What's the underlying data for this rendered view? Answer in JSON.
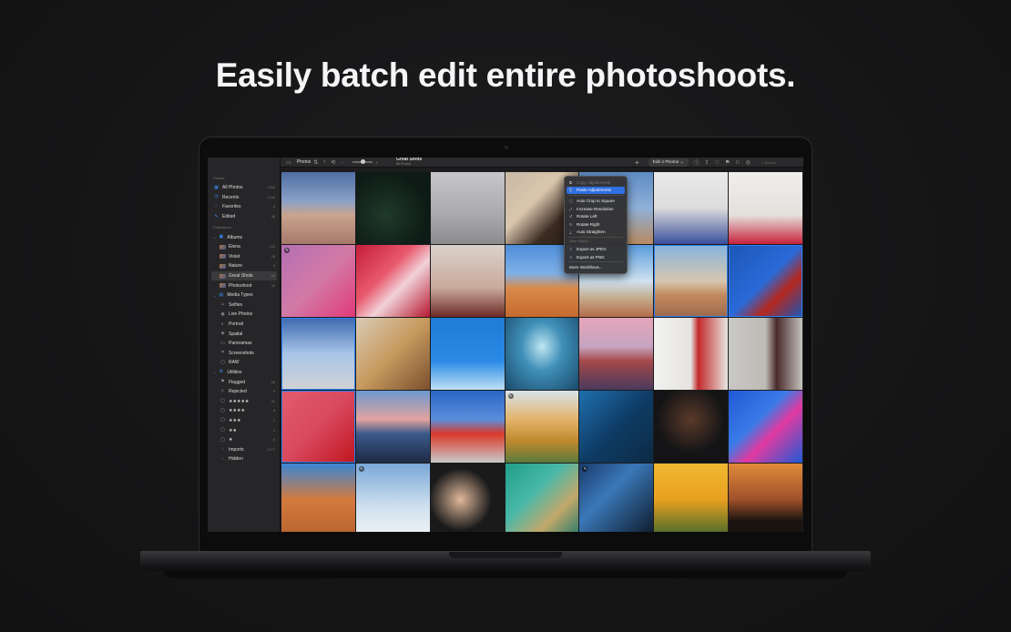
{
  "headline": "Easily batch edit entire photoshoots.",
  "sidebar": {
    "sections": [
      {
        "header": "Photos",
        "items": [
          {
            "label": "All Photos",
            "count": "1250",
            "icon": "photos-icon"
          },
          {
            "label": "Recents",
            "count": "1246",
            "icon": "clock-icon"
          },
          {
            "label": "Favorites",
            "count": "8",
            "icon": "heart-icon"
          },
          {
            "label": "Edited",
            "count": "48",
            "icon": "edit-icon"
          }
        ]
      },
      {
        "header": "Collections",
        "items": []
      }
    ],
    "albums_label": "Albums",
    "albums": [
      {
        "label": "Elena",
        "count": "124"
      },
      {
        "label": "Violet",
        "count": "26"
      },
      {
        "label": "Nature",
        "count": "9"
      },
      {
        "label": "Great Shots",
        "count": "66"
      },
      {
        "label": "Photoshoot",
        "count": "32"
      }
    ],
    "media_types_label": "Media Types",
    "media_types": [
      "Selfies",
      "Live Photos",
      "Portrait",
      "Spatial",
      "Panoramas",
      "Screenshots",
      "RAW"
    ],
    "utilities_label": "Utilities",
    "utilities": [
      {
        "label": "Flagged",
        "count": "26"
      },
      {
        "label": "Rejected",
        "count": "9"
      },
      {
        "label": "★★★★★",
        "count": "31"
      },
      {
        "label": "★★★★",
        "count": "8"
      },
      {
        "label": "★★★",
        "count": "2"
      },
      {
        "label": "★★",
        "count": "3"
      },
      {
        "label": "★",
        "count": "6"
      },
      {
        "label": "Imports",
        "count": "1277"
      },
      {
        "label": "Hidden",
        "count": ""
      }
    ]
  },
  "toolbar": {
    "library_label": "Photos",
    "album_title": "Great Shots",
    "album_subtitle": "66 Photos",
    "edit_button": "Edit 4 Photos",
    "search_placeholder": "Search"
  },
  "menu": {
    "items_top": [
      {
        "label": "Copy Adjustments",
        "disabled": true
      },
      {
        "label": "Paste Adjustments",
        "highlight": true
      }
    ],
    "items_mid": [
      "Auto Crop to Square",
      "Increase Resolution",
      "Rotate Left",
      "Rotate Right",
      "Auto Straighten"
    ],
    "save_header": "Save Export",
    "items_export": [
      "Export as JPEG",
      "Export as PNG"
    ],
    "workflows": "More Workflows..."
  },
  "colors": {
    "accent": "#2f7ff2",
    "background": "#141415"
  },
  "photos": [
    {
      "bg": "linear-gradient(180deg,#4f6ea3 0%,#8aa0c7 40%,#c9a48e 60%,#a7786a 100%)",
      "selected": false
    },
    {
      "bg": "radial-gradient(circle at 40% 60%,#1f3a2a 0%,#0e1a15 70%)",
      "selected": false
    },
    {
      "bg": "linear-gradient(180deg,#c7c7c9 0%,#a9a9ab 60%,#8c8c8e 100%)",
      "selected": false
    },
    {
      "bg": "linear-gradient(135deg,#c8b9a6 0%,#d9c6ad 40%,#3b2b22 70%,#2a1f18 100%)",
      "selected": false
    },
    {
      "bg": "linear-gradient(180deg,#5e8cc4 0%,#8fb0d8 50%,#b78a60 100%)",
      "selected": false
    },
    {
      "bg": "linear-gradient(180deg,#eaeaea 0%,#dcdcdc 50%,#3a4f9c 100%)",
      "selected": false
    },
    {
      "bg": "linear-gradient(180deg,#f0eeec 0%,#e4e0dc 60%,#c8223c 100%)",
      "selected": false
    },
    {
      "bg": "linear-gradient(135deg,#b46fb2 0%,#d27aa6 50%,#e13a7a 100%)",
      "selected": false,
      "badge": true
    },
    {
      "bg": "linear-gradient(135deg,#c41d3a 0%,#e85a6e 40%,#f2d2d8 60%,#b5172e 100%)",
      "selected": false
    },
    {
      "bg": "linear-gradient(180deg,#d9d2cb 0%,#c9a99a 60%,#6b2a25 100%)",
      "selected": false
    },
    {
      "bg": "linear-gradient(180deg,#4f8fd9 0%,#7fb0e6 40%,#d98a4a 60%,#c56a2e 100%)",
      "selected": false
    },
    {
      "bg": "linear-gradient(180deg,#5a9bdc 0%,#cfe2f0 50%,#c4a989 75%,#b46b4a 100%)",
      "selected": false
    },
    {
      "bg": "linear-gradient(180deg,#87b4de 0%,#d6c7b0 50%,#c2895e 70%,#9b6a4e 100%)",
      "selected": true
    },
    {
      "bg": "linear-gradient(135deg,#1b57b7 0%,#2a6ad8 50%,#b4271e 70%,#1b57b7 100%)",
      "selected": true
    },
    {
      "bg": "linear-gradient(180deg,#3d6ab0 0%,#a8c4e8 50%,#d2d2d4 100%)",
      "selected": true
    },
    {
      "bg": "linear-gradient(135deg,#d9cbb6 0%,#c79a5e 50%,#7a4f2e 100%)",
      "selected": false
    },
    {
      "bg": "linear-gradient(180deg,#1e7bd6 0%,#2a8ae6 60%,#bfe0f5 100%)",
      "selected": false
    },
    {
      "bg": "radial-gradient(ellipse at 50% 40%,#bfe6f2 0%,#3f8fb8 40%,#1a4a6a 100%)",
      "selected": false
    },
    {
      "bg": "linear-gradient(180deg,#e6a5b8 0%,#c6a4c2 40%,#a54a4a 60%,#4a3a5c 100%)",
      "selected": false
    },
    {
      "bg": "linear-gradient(90deg,#f2f2f0 0%,#e5e3df 50%,#c22a2a 60%,#e8e6e2 100%)",
      "selected": false
    },
    {
      "bg": "linear-gradient(90deg,#c9c8c4 0%,#bdbbb6 50%,#4a2a2a 65%,#c5c3be 100%)",
      "selected": false
    },
    {
      "bg": "linear-gradient(135deg,#e45b6d 0%,#d9495e 50%,#c0151e 100%)",
      "selected": true
    },
    {
      "bg": "linear-gradient(180deg,#6c9ad0 0%,#e2a3a0 40%,#3a5a8a 60%,#1e2a44 100%)",
      "selected": false
    },
    {
      "bg": "linear-gradient(180deg,#2a66c4 0%,#5a8edb 40%,#d93a2a 60%,#c9c9cb 100%)",
      "selected": false
    },
    {
      "bg": "linear-gradient(180deg,#d9e4ea 0%,#e3b36a 40%,#c0892e 70%,#5a7a3a 100%)",
      "selected": false,
      "badge": true
    },
    {
      "bg": "linear-gradient(135deg,#1e6fb0 0%,#0f3d66 50%,#0c2a44 100%)",
      "selected": false
    },
    {
      "bg": "radial-gradient(circle at 50% 40%,#5b3a2a 0%,#141416 60%)",
      "selected": false
    },
    {
      "bg": "linear-gradient(135deg,#1e5ad6 0%,#3a7ae6 40%,#e03aa0 60%,#1e5ad6 100%)",
      "selected": false
    },
    {
      "bg": "linear-gradient(180deg,#3b86d6 0%,#d47a3e 50%,#b8652e 100%)",
      "selected": false
    },
    {
      "bg": "linear-gradient(180deg,#7aa8d8 0%,#cfe0ee 60%,#eef2f5 100%)",
      "selected": false,
      "badge": true
    },
    {
      "bg": "radial-gradient(circle at 40% 50%,#e0b89a 0%,#1a1a1a 55%)",
      "selected": false
    },
    {
      "bg": "linear-gradient(135deg,#1f9e8a 0%,#4ab8a8 40%,#c2a86a 70%,#2a7a6a 100%)",
      "selected": false
    },
    {
      "bg": "linear-gradient(135deg,#1a3a6a 0%,#3a78b8 40%,#0e1a2a 100%)",
      "selected": false,
      "badge": true
    },
    {
      "bg": "linear-gradient(180deg,#f0b830 0%,#e8a020 50%,#4a6a2a 100%)",
      "selected": false
    },
    {
      "bg": "linear-gradient(180deg,#e08a3a 0%,#a0502a 50%,#1a1410 80%)",
      "selected": false
    }
  ]
}
